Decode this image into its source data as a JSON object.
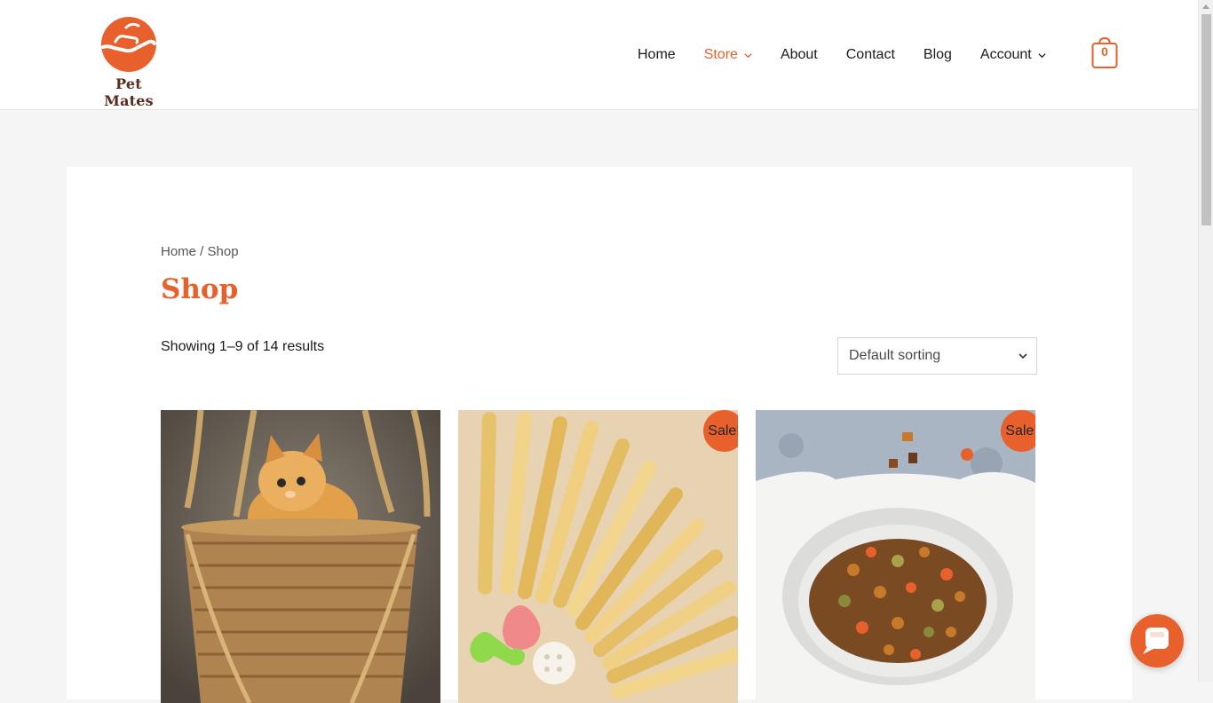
{
  "brand": {
    "name": "Pet Mates",
    "accent_color": "#e8612c"
  },
  "nav": {
    "items": [
      {
        "label": "Home",
        "active": false,
        "has_dropdown": false
      },
      {
        "label": "Store",
        "active": true,
        "has_dropdown": true
      },
      {
        "label": "About",
        "active": false,
        "has_dropdown": false
      },
      {
        "label": "Contact",
        "active": false,
        "has_dropdown": false
      },
      {
        "label": "Blog",
        "active": false,
        "has_dropdown": false
      },
      {
        "label": "Account",
        "active": false,
        "has_dropdown": true
      }
    ],
    "cart_count": "0"
  },
  "breadcrumb": {
    "home": "Home",
    "separator": " / ",
    "current": "Shop"
  },
  "page_title": "Shop",
  "result_count": "Showing 1–9 of 14 results",
  "sorting": {
    "selected": "Default sorting"
  },
  "products": [
    {
      "image": "kitten-in-wicker-basket",
      "sale": false,
      "badge": ""
    },
    {
      "image": "chew-sticks-and-treats",
      "sale": true,
      "badge": "Sale!"
    },
    {
      "image": "kibble-in-cat-bowl",
      "sale": true,
      "badge": "Sale!"
    }
  ],
  "icons": {
    "cart": "shopping-bag-icon",
    "chevron": "chevron-down-icon",
    "chat": "chat-bubble-icon"
  }
}
